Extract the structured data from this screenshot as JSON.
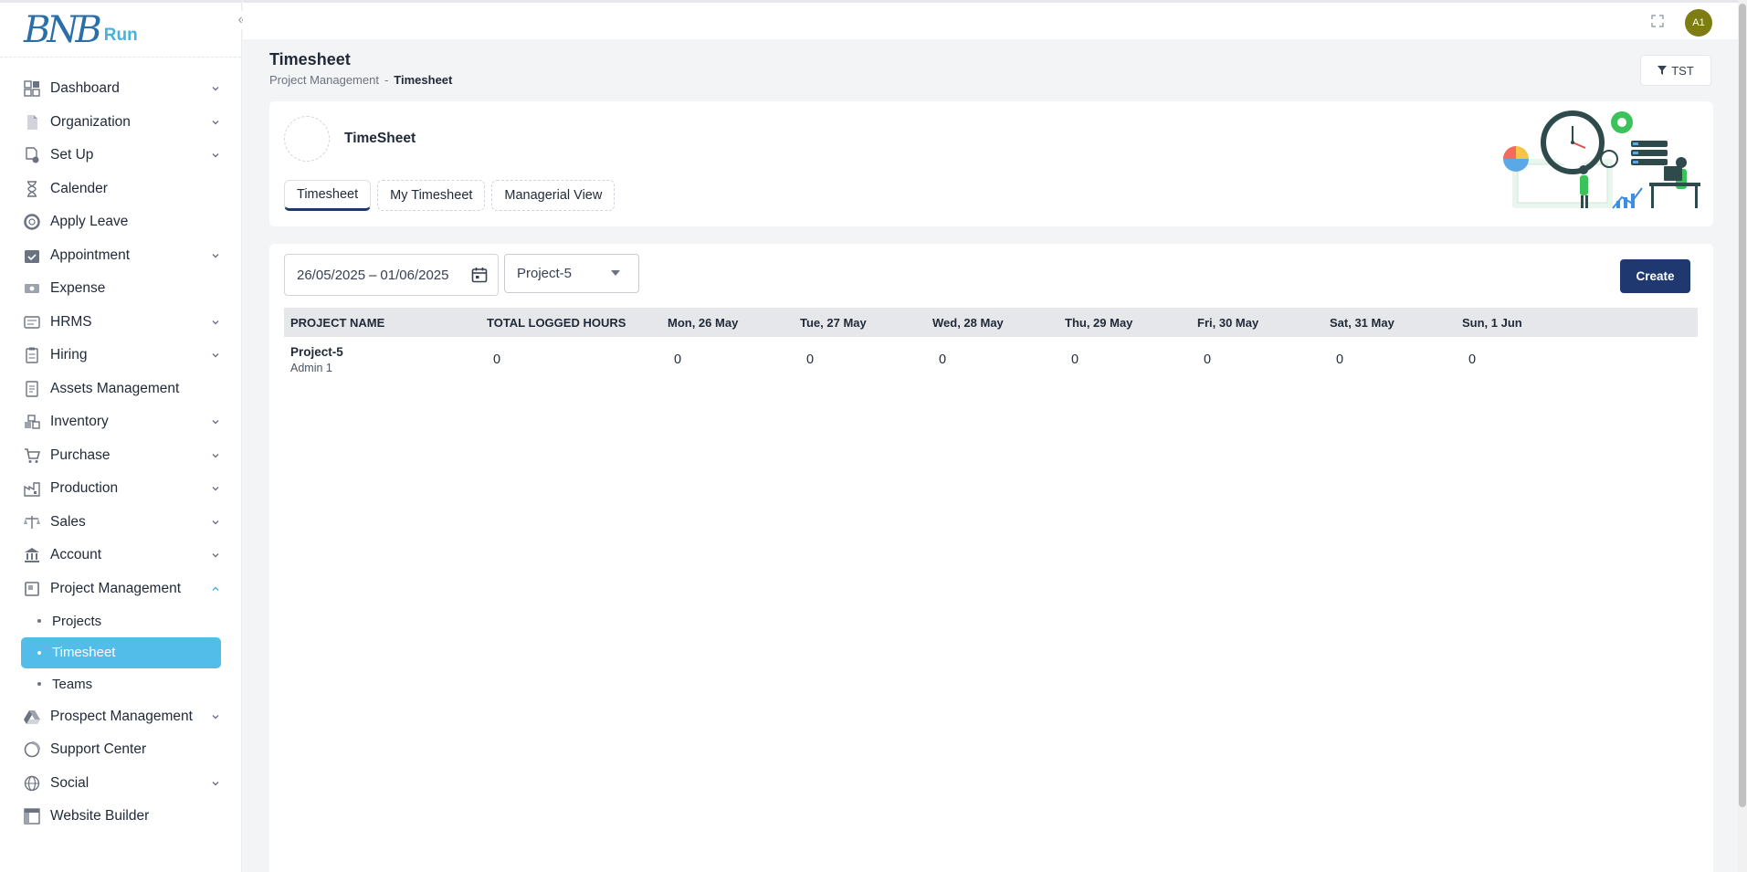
{
  "brand": {
    "logo_text": "BNB",
    "logo_run": "Run"
  },
  "sidebar": {
    "items": [
      {
        "label": "Dashboard",
        "icon": "dashboard-icon",
        "has_children": true
      },
      {
        "label": "Organization",
        "icon": "file-icon",
        "has_children": true
      },
      {
        "label": "Set Up",
        "icon": "settings-file-icon",
        "has_children": true
      },
      {
        "label": "Calender",
        "icon": "hourglass-icon",
        "has_children": false
      },
      {
        "label": "Apply Leave",
        "icon": "lifebuoy-icon",
        "has_children": false
      },
      {
        "label": "Appointment",
        "icon": "calendar-check-icon",
        "has_children": true
      },
      {
        "label": "Expense",
        "icon": "money-icon",
        "has_children": false
      },
      {
        "label": "HRMS",
        "icon": "id-card-icon",
        "has_children": true
      },
      {
        "label": "Hiring",
        "icon": "clipboard-icon",
        "has_children": true
      },
      {
        "label": "Assets Management",
        "icon": "document-icon",
        "has_children": false
      },
      {
        "label": "Inventory",
        "icon": "boxes-icon",
        "has_children": true
      },
      {
        "label": "Purchase",
        "icon": "cart-icon",
        "has_children": true
      },
      {
        "label": "Production",
        "icon": "factory-icon",
        "has_children": true
      },
      {
        "label": "Sales",
        "icon": "scale-icon",
        "has_children": true
      },
      {
        "label": "Account",
        "icon": "bank-icon",
        "has_children": true
      },
      {
        "label": "Project Management",
        "icon": "project-icon",
        "has_children": true,
        "expanded": true
      },
      {
        "label": "Prospect Management",
        "icon": "drive-icon",
        "has_children": true
      },
      {
        "label": "Support Center",
        "icon": "support-icon",
        "has_children": false
      },
      {
        "label": "Social",
        "icon": "globe-icon",
        "has_children": true
      },
      {
        "label": "Website Builder",
        "icon": "layout-icon",
        "has_children": false
      }
    ],
    "project_sub_items": [
      {
        "label": "Projects",
        "active": false
      },
      {
        "label": "Timesheet",
        "active": true
      },
      {
        "label": "Teams",
        "active": false
      }
    ]
  },
  "topbar": {
    "avatar_initials": "A1"
  },
  "header": {
    "title": "Timesheet",
    "breadcrumb_parent": "Project Management",
    "breadcrumb_sep": "-",
    "breadcrumb_current": "Timesheet",
    "filter_label": "TST"
  },
  "card": {
    "heading": "TimeSheet",
    "tabs": [
      {
        "label": "Timesheet",
        "active": true
      },
      {
        "label": "My Timesheet",
        "active": false
      },
      {
        "label": "Managerial View",
        "active": false
      }
    ]
  },
  "filters": {
    "date_start": "26/05/2025",
    "date_sep": "–",
    "date_end": "01/06/2025",
    "project_selected": "Project-5",
    "create_label": "Create"
  },
  "table": {
    "columns": [
      "PROJECT NAME",
      "TOTAL LOGGED HOURS",
      "Mon, 26 May",
      "Tue, 27 May",
      "Wed, 28 May",
      "Thu, 29 May",
      "Fri, 30 May",
      "Sat, 31 May",
      "Sun, 1 Jun"
    ],
    "rows": [
      {
        "project": "Project-5",
        "user": "Admin 1",
        "total": "0",
        "days": [
          "0",
          "0",
          "0",
          "0",
          "0",
          "0",
          "0"
        ]
      }
    ]
  },
  "colors": {
    "accent": "#52bde9",
    "primary": "#1f3870",
    "avatar": "#7d7d14"
  }
}
